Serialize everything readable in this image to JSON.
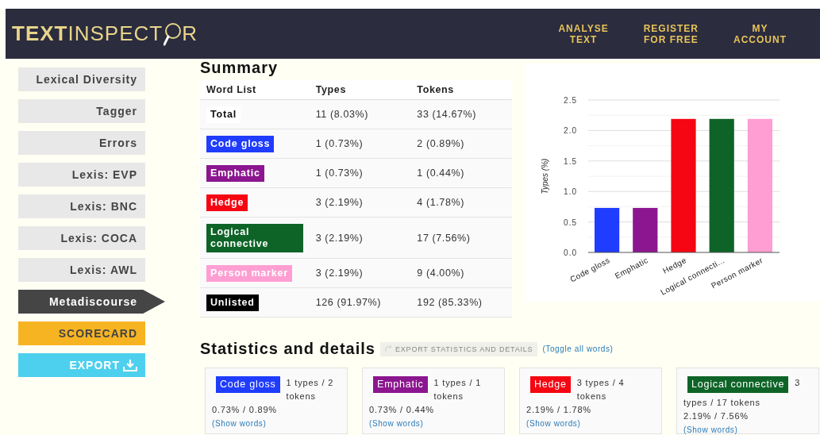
{
  "header": {
    "logo": {
      "bold": "TEXT",
      "light": "INSPECT",
      "tail": "R"
    },
    "nav": [
      {
        "label": "ANALYSE\nTEXT"
      },
      {
        "label": "REGISTER\nFOR FREE"
      },
      {
        "label": "MY\nACCOUNT"
      }
    ]
  },
  "sidebar": {
    "items": [
      {
        "label": "Lexical Diversity",
        "kind": "nav",
        "selected": false
      },
      {
        "label": "Tagger",
        "kind": "nav",
        "selected": false
      },
      {
        "label": "Errors",
        "kind": "nav",
        "selected": false
      },
      {
        "label": "Lexis: EVP",
        "kind": "nav",
        "selected": false
      },
      {
        "label": "Lexis: BNC",
        "kind": "nav",
        "selected": false
      },
      {
        "label": "Lexis: COCA",
        "kind": "nav",
        "selected": false
      },
      {
        "label": "Lexis: AWL",
        "kind": "nav",
        "selected": false
      },
      {
        "label": "Metadiscourse",
        "kind": "nav",
        "selected": true
      },
      {
        "label": "SCORECARD",
        "kind": "scorecard",
        "selected": false
      },
      {
        "label": "EXPORT",
        "kind": "export",
        "selected": false
      }
    ]
  },
  "summary": {
    "title": "Summary",
    "columns": [
      "Word List",
      "Types",
      "Tokens"
    ],
    "rows": [
      {
        "label": "Total",
        "types": "11 (8.03%)",
        "tokens": "33 (14.67%)"
      },
      {
        "label": "Code gloss",
        "color": "#1f3cff",
        "types": "1 (0.73%)",
        "tokens": "2 (0.89%)"
      },
      {
        "label": "Emphatic",
        "color": "#8b168f",
        "types": "1 (0.73%)",
        "tokens": "1 (0.44%)"
      },
      {
        "label": "Hedge",
        "color": "#f50612",
        "types": "3 (2.19%)",
        "tokens": "4 (1.78%)"
      },
      {
        "label": "Logical connective",
        "color": "#0e6427",
        "types": "3 (2.19%)",
        "tokens": "17 (7.56%)"
      },
      {
        "label": "Person marker",
        "color": "#ff9ed2",
        "types": "3 (2.19%)",
        "tokens": "9 (4.00%)"
      },
      {
        "label": "Unlisted",
        "color": "#000000",
        "types": "126 (91.97%)",
        "tokens": "192 (85.33%)"
      }
    ],
    "chart_data": {
      "type": "bar",
      "ylabel": "Types (%)",
      "categories": [
        "Code gloss",
        "Emphatic",
        "Hedge",
        "Logical connecti...",
        "Person marker"
      ],
      "values": [
        0.73,
        0.73,
        2.19,
        2.19,
        2.19
      ],
      "grid": true,
      "colors": [
        "#1f3cff",
        "#8b168f",
        "#f50612",
        "#0e6427",
        "#ff9ed2"
      ],
      "ylim": [
        0,
        2.5
      ],
      "yticks": [
        {
          "value": 0,
          "label": "0.0"
        },
        {
          "value": 0.5,
          "label": "0.5"
        },
        {
          "value": 1,
          "label": "1.0"
        },
        {
          "value": 1.5,
          "label": "1.5"
        },
        {
          "value": 2,
          "label": "2.0"
        },
        {
          "value": 2.5,
          "label": "2.5"
        }
      ]
    }
  },
  "statistics": {
    "title": "Statistics and details",
    "export_button": "EXPORT STATISTICS AND DETAILS",
    "toggle_link": "(Toggle all words)",
    "cards": [
      {
        "label": "Code gloss",
        "color": "#1f3cff",
        "counts": [
          "1 types / 2",
          "tokens"
        ],
        "percent": "0.73% / 0.89%",
        "link": "(Show words)"
      },
      {
        "label": "Emphatic",
        "color": "#8b168f",
        "counts": [
          "1 types / 1",
          "tokens"
        ],
        "percent": "0.73% / 0.44%",
        "link": "(Show words)"
      },
      {
        "label": "Hedge",
        "color": "#f50612",
        "counts": [
          "3 types / 4",
          "tokens"
        ],
        "percent": "2.19% / 1.78%",
        "link": "(Show words)"
      },
      {
        "label": "Logical connective",
        "color": "#0e6427",
        "counts": [
          "3",
          "types / 17 tokens"
        ],
        "percent": "2.19% / 7.56%",
        "link": "(Show words)"
      }
    ]
  }
}
